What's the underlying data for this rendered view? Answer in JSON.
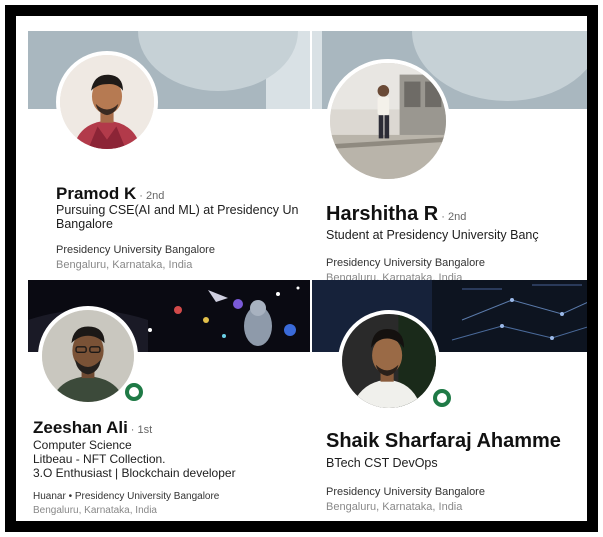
{
  "cards": [
    {
      "name": "Pramod K",
      "degree": "2nd",
      "headline": [
        "Pursuing CSE(AI and ML) at Presidency Un",
        "Bangalore"
      ],
      "school": "Presidency University Bangalore",
      "location": "Bengaluru, Karnataka, India",
      "open_to_work": false,
      "banner": "grey"
    },
    {
      "name": "Harshitha R",
      "degree": "2nd",
      "headline": [
        "Student at Presidency University Banç"
      ],
      "school": "Presidency University Bangalore",
      "location": "Bengaluru, Karnataka, India",
      "open_to_work": false,
      "banner": "grey"
    },
    {
      "name": "Zeeshan Ali",
      "degree": "1st",
      "headline": [
        "Computer Science",
        "Litbeau - NFT Collection.",
        "3.O Enthusiast | Blockchain developer"
      ],
      "school": "Huanar • Presidency University Bangalore",
      "location": "Bengaluru, Karnataka, India",
      "open_to_work": true,
      "banner": "space"
    },
    {
      "name": "Shaik Sharfaraj Ahamme",
      "degree": "",
      "headline": [
        "BTech CST DevOps"
      ],
      "school": "Presidency University Bangalore",
      "location": "Bengaluru, Karnataka, India",
      "open_to_work": true,
      "banner": "network"
    }
  ],
  "colors": {
    "frame": "#000000",
    "banner_grey": "#a9b7bf",
    "open_to_work_ring": "#1f7a46",
    "secondary_text": "#888888"
  }
}
